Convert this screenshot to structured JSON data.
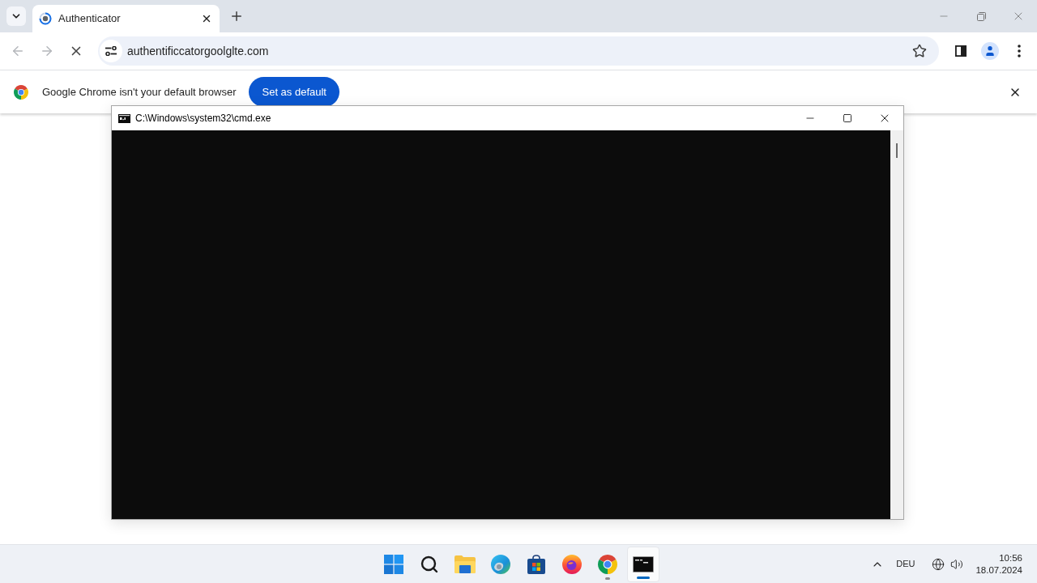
{
  "browser": {
    "tabs": [
      {
        "title": "Authenticator",
        "selected": true
      }
    ],
    "back": {
      "disabled": true
    },
    "forward": {
      "disabled": true
    },
    "loading": true,
    "address": "authentificcatorgoolglte.com",
    "infobar": {
      "message": "Google Chrome isn't your default browser",
      "button": "Set as default"
    }
  },
  "console_window": {
    "title": "C:\\Windows\\system32\\cmd.exe"
  },
  "taskbar": {
    "apps": [
      {
        "kind": "start",
        "running": false,
        "active": false
      },
      {
        "kind": "search",
        "running": false,
        "active": false
      },
      {
        "kind": "folder",
        "running": false,
        "active": false
      },
      {
        "kind": "swirl",
        "running": false,
        "active": false
      },
      {
        "kind": "bag",
        "running": false,
        "active": false
      },
      {
        "kind": "flame",
        "running": false,
        "active": false
      },
      {
        "kind": "tricolor",
        "running": true,
        "active": false
      },
      {
        "kind": "console",
        "running": true,
        "active": true
      }
    ],
    "tray": {
      "language": "DEU",
      "time": "10:56",
      "date": "18.07.2024"
    }
  }
}
